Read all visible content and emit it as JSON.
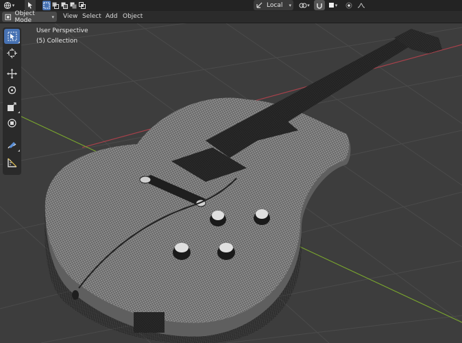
{
  "header": {
    "mode_label": "Object Mode",
    "menus": [
      "View",
      "Select",
      "Add",
      "Object"
    ],
    "transform_orientation": "Local"
  },
  "viewport": {
    "view_name": "User Perspective",
    "collection_label": "(5) Collection"
  },
  "colors": {
    "accent": "#4772b3",
    "x_axis": "#a8414b",
    "y_axis": "#7aa62e",
    "grid": "#4b4b4b",
    "background": "#3d3d3d"
  },
  "toolbar": {
    "tools": [
      "select-box",
      "cursor",
      "move",
      "rotate",
      "scale",
      "transform",
      "annotate",
      "measure"
    ],
    "active_tool": "select-box"
  }
}
